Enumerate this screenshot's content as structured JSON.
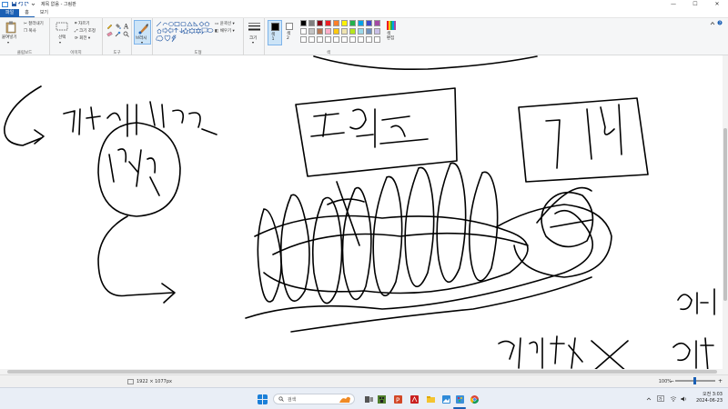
{
  "window": {
    "title": "제목 없음 - 그림판",
    "controls": [
      "—",
      "☐",
      "✕"
    ]
  },
  "menu": {
    "tabs": [
      "파일",
      "홈",
      "보기"
    ]
  },
  "ribbon": {
    "clipboard": {
      "paste": "붙여넣기",
      "cut": "잘라내기",
      "copy": "복사",
      "label": "클립보드"
    },
    "image": {
      "select": "선택",
      "crop": "자르기",
      "resize": "크기 조정",
      "rotate": "회전",
      "label": "이미지"
    },
    "tools": {
      "label": "도구"
    },
    "brushes": {
      "label": "브러시"
    },
    "shapes": {
      "outline": "윤곽선",
      "fill": "채우기",
      "label": "도형"
    },
    "size": {
      "label": "크기"
    },
    "colors": {
      "color1": "색\n1",
      "color2": "색\n2",
      "edit": "색\n편집",
      "label": "색",
      "palette_row1": [
        "#000000",
        "#7f7f7f",
        "#880015",
        "#ed1c24",
        "#ff7f27",
        "#fff200",
        "#22b14c",
        "#00a2e8",
        "#3f48cc",
        "#a349a4"
      ],
      "palette_row2": [
        "#ffffff",
        "#c3c3c3",
        "#b97a57",
        "#ffaec9",
        "#ffc90e",
        "#efe4b0",
        "#b5e61d",
        "#99d9ea",
        "#7092be",
        "#c8bfe7"
      ]
    }
  },
  "status": {
    "canvas_size": "1922 × 1077px",
    "zoom": "100%"
  },
  "taskbar": {
    "search_placeholder": "검색",
    "time": "오전 3:03",
    "date": "2024-06-23"
  }
}
